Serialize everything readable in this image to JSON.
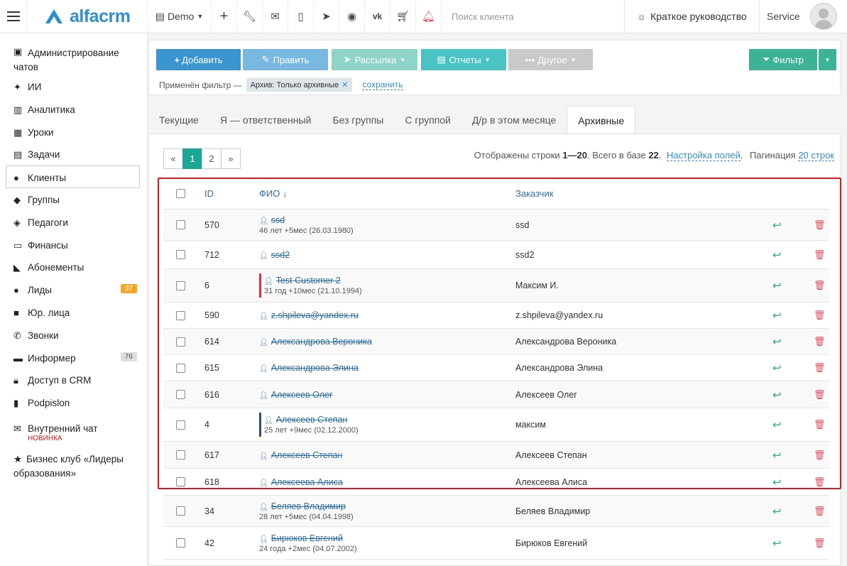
{
  "topbar": {
    "logo_text": "alfacrm",
    "demo_label": "Demo",
    "search_placeholder": "Поиск клиента",
    "guide_label": "Краткое руководство",
    "user_label": "Service"
  },
  "sidebar": {
    "items": [
      {
        "label": "Администрирование чатов",
        "icon": "admin-chat-icon"
      },
      {
        "label": "ИИ",
        "icon": "sparkle-icon"
      },
      {
        "label": "Аналитика",
        "icon": "map-icon"
      },
      {
        "label": "Уроки",
        "icon": "calendar-icon"
      },
      {
        "label": "Задачи",
        "icon": "clipboard-icon"
      },
      {
        "label": "Клиенты",
        "icon": "user-icon"
      },
      {
        "label": "Группы",
        "icon": "users-icon"
      },
      {
        "label": "Педагоги",
        "icon": "graduation-cap-icon"
      },
      {
        "label": "Финансы",
        "icon": "money-icon"
      },
      {
        "label": "Абонементы",
        "icon": "tag-icon"
      },
      {
        "label": "Лиды",
        "icon": "user-plus-icon",
        "badge": "37"
      },
      {
        "label": "Юр. лица",
        "icon": "briefcase-icon"
      },
      {
        "label": "Звонки",
        "icon": "phone-icon"
      },
      {
        "label": "Информер",
        "icon": "inbox-icon",
        "badge": "76"
      },
      {
        "label": "Доступ в CRM",
        "icon": "lock-icon"
      },
      {
        "label": "Podpislon",
        "icon": "document-icon"
      },
      {
        "label": "Внутренний чат",
        "icon": "envelope-icon",
        "sub": "НОВИНКА"
      },
      {
        "label": "Бизнес клуб «Лидеры образования»",
        "icon": "star-icon"
      }
    ]
  },
  "toolbar": {
    "add_label": "Добавить",
    "edit_label": "Править",
    "mail_label": "Рассылка",
    "reports_label": "Отчеты",
    "other_label": "Другое",
    "filter_label": "Фильтр",
    "applied_filter_label": "Применён фильтр —",
    "filter_chip": "Архив: Только архивные",
    "save_label": "сохранить"
  },
  "tabs": [
    "Текущие",
    "Я — ответственный",
    "Без группы",
    "С группой",
    "Д/р в этом месяце",
    "Архивные"
  ],
  "pager": {
    "prev": "«",
    "pages": [
      "1",
      "2"
    ],
    "next": "»"
  },
  "info": {
    "prefix": "Отображены строки",
    "range_from": "1",
    "range_sep": "—",
    "range_to": "20",
    "total_text": ". Всего в базе",
    "total": "22",
    "dot": ".",
    "settings_link": "Настройка полей",
    "pagination_label": "Пагинация",
    "pagination_value": "20 строк"
  },
  "table": {
    "headers": {
      "id": "ID",
      "name": "ФИО ↓",
      "customer": "Заказчик"
    },
    "rows": [
      {
        "id": "570",
        "name": "ssd",
        "meta": "46 лет +5мес (26.03.1980)",
        "customer": "ssd",
        "marker": ""
      },
      {
        "id": "712",
        "name": "ssd2",
        "meta": "",
        "customer": "ssd2",
        "marker": ""
      },
      {
        "id": "6",
        "name": "Test Customer 2",
        "meta": "31 год +10мес (21.10.1994)",
        "customer": "Максим И.",
        "marker": "red"
      },
      {
        "id": "590",
        "name": "z.shpileva@yandex.ru",
        "meta": "",
        "customer": "z.shpileva@yandex.ru",
        "marker": ""
      },
      {
        "id": "614",
        "name": "Александрова Вероника",
        "meta": "",
        "customer": "Александрова Вероника",
        "marker": ""
      },
      {
        "id": "615",
        "name": "Александрова Элина",
        "meta": "",
        "customer": "Александрова Элина",
        "marker": ""
      },
      {
        "id": "616",
        "name": "Алексеев Олег",
        "meta": "",
        "customer": "Алексеев Олег",
        "marker": ""
      },
      {
        "id": "4",
        "name": "Алексеев Степан",
        "meta": "25 лет +9мес (02.12.2000)",
        "customer": "максим",
        "marker": "blue"
      },
      {
        "id": "617",
        "name": "Алексеев Степан",
        "meta": "",
        "customer": "Алексеев Степан",
        "marker": ""
      },
      {
        "id": "618",
        "name": "Алексеева Алиса",
        "meta": "",
        "customer": "Алексеева Алиса",
        "marker": ""
      },
      {
        "id": "34",
        "name": "Беляев Владимир",
        "meta": "28 лет +5мес (04.04.1998)",
        "customer": "Беляев Владимир",
        "marker": ""
      },
      {
        "id": "42",
        "name": "Бирюков Евгений",
        "meta": "24 года +2мес (04.07.2002)",
        "customer": "Бирюков Евгений",
        "marker": ""
      }
    ]
  },
  "colors": {
    "accent": "#3a95d1",
    "highlight": "#d8171e",
    "active_page": "#1da596"
  }
}
